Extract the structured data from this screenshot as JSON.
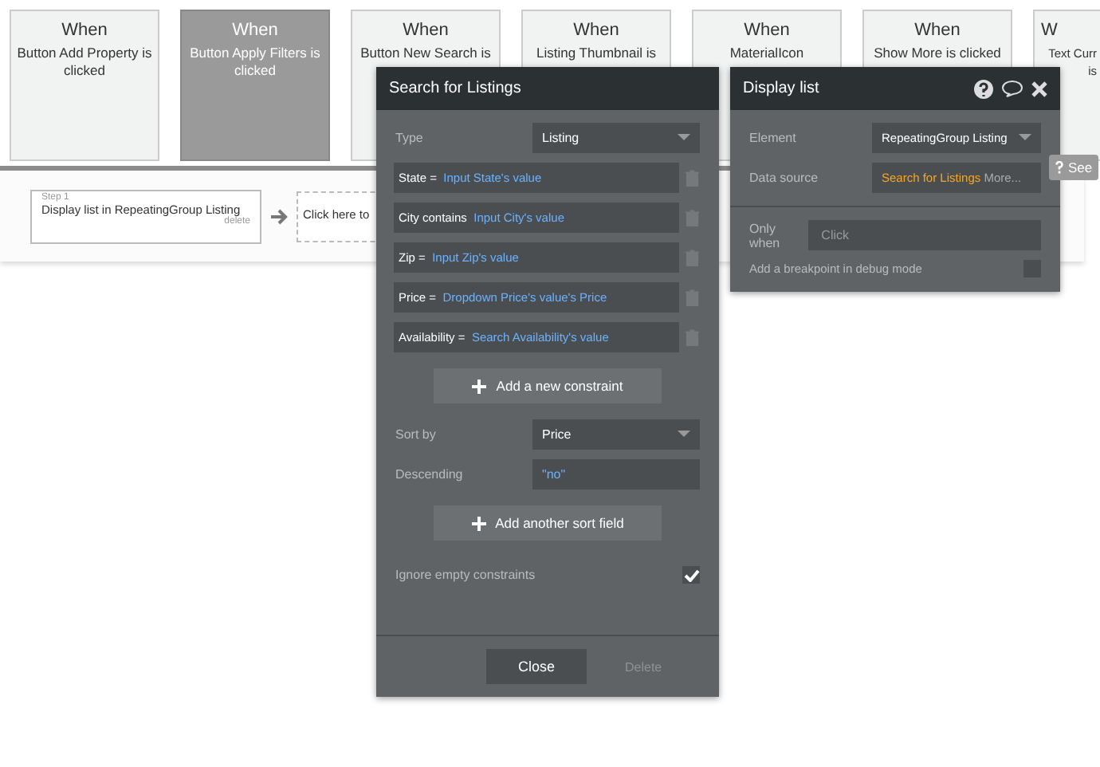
{
  "events": [
    {
      "title": "When",
      "text": "Button Add Property is clicked",
      "selected": false
    },
    {
      "title": "When",
      "text": "Button Apply Filters is clicked",
      "selected": true
    },
    {
      "title": "When",
      "text": "Button New Search is",
      "selected": false
    },
    {
      "title": "When",
      "text": "Listing Thumbnail is",
      "selected": false
    },
    {
      "title": "When",
      "text": "MaterialIcon",
      "selected": false
    },
    {
      "title": "When",
      "text": "Show More is clicked",
      "selected": false
    },
    {
      "title": "W",
      "text": "Text Curr is",
      "selected": false
    }
  ],
  "steps": [
    {
      "label": "Step 1",
      "text": "Display list in RepeatingGroup Listing",
      "delete": "delete"
    }
  ],
  "next_step": "Click here to",
  "search_dialog": {
    "title": "Search for Listings",
    "type_label": "Type",
    "type_value": "Listing",
    "constraints": [
      {
        "key": "State =",
        "value": "Input State's value"
      },
      {
        "key": "City contains",
        "value": "Input City's value"
      },
      {
        "key": "Zip =",
        "value": "Input Zip's value"
      },
      {
        "key": "Price =",
        "value": "Dropdown Price's value's Price"
      },
      {
        "key": "Availability =",
        "value": "Search Availability's value"
      }
    ],
    "add_constraint": "Add a new constraint",
    "sort_label": "Sort by",
    "sort_value": "Price",
    "desc_label": "Descending",
    "desc_value": "\"no\"",
    "add_sort": "Add another sort field",
    "ignore_label": "Ignore empty constraints",
    "ignore_checked": true,
    "close": "Close",
    "delete": "Delete"
  },
  "action_dialog": {
    "title": "Display list",
    "element_label": "Element",
    "element_value": "RepeatingGroup Listing",
    "source_label": "Data source",
    "source_value": "Search for Listings",
    "source_more": "More...",
    "when_label": "Only when",
    "when_placeholder": "Click",
    "breakpoint_label": "Add a breakpoint in debug mode",
    "breakpoint_checked": false
  },
  "tooltip": "See"
}
